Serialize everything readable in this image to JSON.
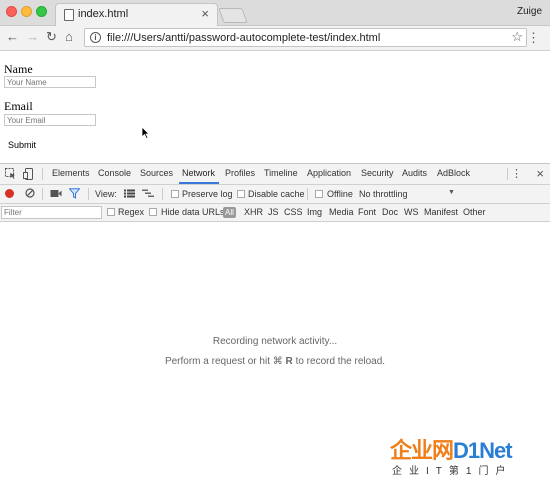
{
  "browser": {
    "tab_title": "index.html",
    "tab_close": "×",
    "profile_name": "Zuige",
    "url": "file:///Users/antti/password-autocomplete-test/index.html",
    "nav": {
      "back": "←",
      "forward": "→",
      "reload": "↻",
      "home": "⌂",
      "info": "i",
      "star": "☆",
      "menu": "⋮"
    }
  },
  "page": {
    "name_label": "Name",
    "name_placeholder": "Your Name",
    "email_label": "Email",
    "email_placeholder": "Your Email",
    "submit_label": "Submit"
  },
  "devtools": {
    "tabs": [
      "Elements",
      "Console",
      "Sources",
      "Network",
      "Profiles",
      "Timeline",
      "Application",
      "Security",
      "Audits",
      "AdBlock"
    ],
    "active_tab": "Network",
    "more": "⋮",
    "close": "×",
    "network": {
      "view_label": "View:",
      "preserve_log": "Preserve log",
      "disable_cache": "Disable cache",
      "offline": "Offline",
      "throttling": "No throttling",
      "throttling_arrow": "▼"
    },
    "filter": {
      "placeholder": "Filter",
      "regex": "Regex",
      "hide_data_urls": "Hide data URLs",
      "all": "All",
      "types": [
        "XHR",
        "JS",
        "CSS",
        "Img",
        "Media",
        "Font",
        "Doc",
        "WS",
        "Manifest",
        "Other"
      ]
    },
    "empty": {
      "line1": "Recording network activity...",
      "line2_prefix": "Perform a request or hit ⌘",
      "line2_key": "R",
      "line2_suffix": "to record the reload."
    }
  },
  "watermark": {
    "main_left": "企业网",
    "main_right": "D1Net",
    "sub": "企业IT第1门户"
  },
  "colors": {
    "accent": "#3879d9",
    "record": "#d93025",
    "watermark_orange": "#f07e1a",
    "watermark_blue": "#2a7fd4"
  }
}
